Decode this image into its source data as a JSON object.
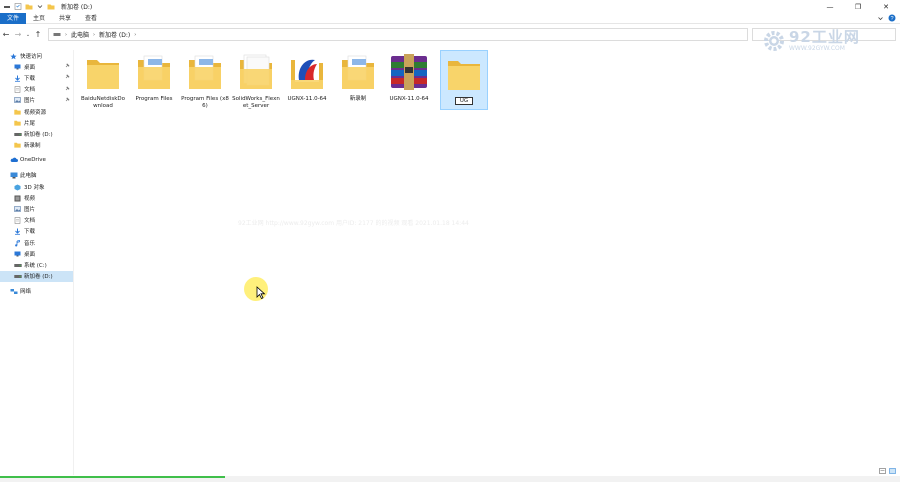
{
  "titlebar": {
    "title": "新加卷 (D:)",
    "minimize": "—",
    "maximize": "❐",
    "close": "✕"
  },
  "ribbon": {
    "tabs": [
      "文件",
      "主页",
      "共享",
      "查看"
    ]
  },
  "address": {
    "crumbs": [
      "此电脑",
      "新加卷 (D:)"
    ]
  },
  "logo": {
    "main": "92工业网",
    "url": "WWW.92GYW.COM"
  },
  "sidebar": {
    "items": [
      {
        "label": "快速访问",
        "level": 0,
        "icon": "star-icon",
        "color": "#2b78d8",
        "pin": false
      },
      {
        "label": "桌面",
        "level": 1,
        "icon": "desktop-icon",
        "color": "#2b78d8",
        "pin": true
      },
      {
        "label": "下载",
        "level": 1,
        "icon": "download-icon",
        "color": "#2b78d8",
        "pin": true
      },
      {
        "label": "文档",
        "level": 1,
        "icon": "document-icon",
        "color": "#8a8a8a",
        "pin": true
      },
      {
        "label": "图片",
        "level": 1,
        "icon": "picture-icon",
        "color": "#5a7da8",
        "pin": true
      },
      {
        "label": "视频资源",
        "level": 1,
        "icon": "folder-icon",
        "color": "#f4c64c",
        "pin": false
      },
      {
        "label": "片尾",
        "level": 1,
        "icon": "folder-icon",
        "color": "#f4c64c",
        "pin": false
      },
      {
        "label": "新加卷 (D:)",
        "level": 1,
        "icon": "drive-icon",
        "color": "#666666",
        "pin": false
      },
      {
        "label": "新录制",
        "level": 1,
        "icon": "folder-icon",
        "color": "#f4c64c",
        "pin": false
      },
      {
        "label": "",
        "level": -1
      },
      {
        "label": "OneDrive",
        "level": 0,
        "icon": "cloud-icon",
        "color": "#1f6fd1",
        "pin": false
      },
      {
        "label": "",
        "level": -1
      },
      {
        "label": "此电脑",
        "level": 0,
        "icon": "computer-icon",
        "color": "#3a8ad8",
        "pin": false
      },
      {
        "label": "3D 对象",
        "level": 1,
        "icon": "cube-icon",
        "color": "#4aa3e0",
        "pin": false
      },
      {
        "label": "视频",
        "level": 1,
        "icon": "video-icon",
        "color": "#555555",
        "pin": false
      },
      {
        "label": "图片",
        "level": 1,
        "icon": "picture-icon",
        "color": "#5a7da8",
        "pin": false
      },
      {
        "label": "文档",
        "level": 1,
        "icon": "document-icon",
        "color": "#8a8a8a",
        "pin": false
      },
      {
        "label": "下载",
        "level": 1,
        "icon": "download-icon",
        "color": "#2b78d8",
        "pin": false
      },
      {
        "label": "音乐",
        "level": 1,
        "icon": "music-icon",
        "color": "#2b78d8",
        "pin": false
      },
      {
        "label": "桌面",
        "level": 1,
        "icon": "desktop-icon",
        "color": "#2b78d8",
        "pin": false
      },
      {
        "label": "系统 (C:)",
        "level": 1,
        "icon": "drive-icon",
        "color": "#666666",
        "pin": false
      },
      {
        "label": "新加卷 (D:)",
        "level": 1,
        "icon": "drive-icon",
        "color": "#666666",
        "pin": false,
        "selected": true
      },
      {
        "label": "",
        "level": -1
      },
      {
        "label": "网络",
        "level": 0,
        "icon": "network-icon",
        "color": "#3a8ad8",
        "pin": false
      }
    ]
  },
  "files": [
    {
      "name": "BaiduNetdiskDownload",
      "type": "folder-plain"
    },
    {
      "name": "Program Files",
      "type": "folder-docs"
    },
    {
      "name": "Program Files (x86)",
      "type": "folder-docs"
    },
    {
      "name": "SolidWorks_Flexnet_Server",
      "type": "folder-white"
    },
    {
      "name": "UGNX-11.0-64",
      "type": "folder-app"
    },
    {
      "name": "新录制",
      "type": "folder-docs"
    },
    {
      "name": "UGNX-11.0-64",
      "type": "winrar-archive"
    },
    {
      "name": "UG",
      "type": "folder-plain",
      "selected": true,
      "renaming": true
    }
  ],
  "watermark": {
    "text": "92工业网 http://www.92gyw.com 用户ID: 2177 的的视频 观看 2021.01.18 14:44"
  },
  "progress": 0.25
}
